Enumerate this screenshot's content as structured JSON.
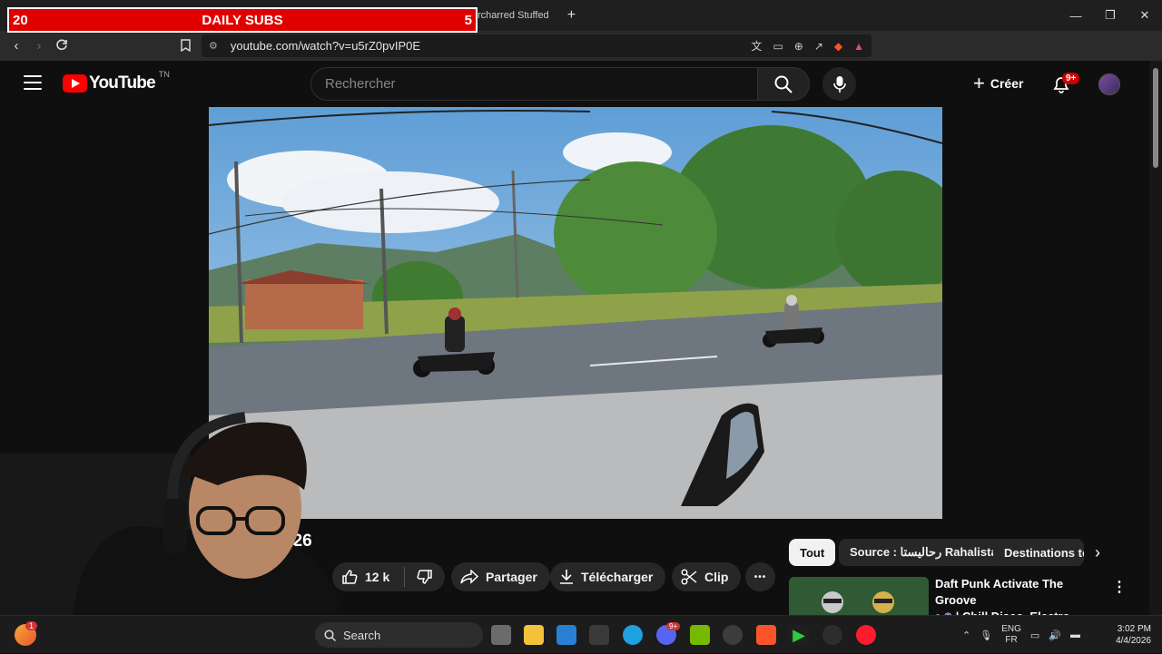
{
  "overlay": {
    "left_number": "20",
    "title": "DAILY SUBS",
    "right_number": "5"
  },
  "browser": {
    "tab_text": "rcharred Stuffed",
    "new_tab": "+",
    "url": "youtube.com/watch?v=u5rZ0pvIP0E",
    "window_controls": [
      "—",
      "❐",
      "✕"
    ]
  },
  "youtube": {
    "logo_text": "YouTube",
    "country_code": "TN",
    "search_placeholder": "Rechercher",
    "create_label": "Créer",
    "notification_badge": "9+",
    "video_title_visible": "026",
    "like_count": "12 k",
    "share_label": "Partager",
    "download_label": "Télécharger",
    "clip_label": "Clip",
    "more_label": "•••",
    "chips": [
      "Tout",
      "Source : رحاليستا Rahalista",
      "Destinations to"
    ],
    "recommendation": {
      "title": "Daft Punk Activate The Groove",
      "subtitle": "| Chill Disco, Electro ..."
    }
  },
  "taskbar": {
    "search_label": "Search",
    "notification_count": "1",
    "discord_badge": "9+",
    "lang_top": "ENG",
    "lang_bottom": "FR",
    "time": "3:02 PM",
    "date": "4/4/2026"
  },
  "colors": {
    "yt_red": "#ff0000",
    "overlay_red": "#e10000",
    "background": "#0f0f0f"
  }
}
